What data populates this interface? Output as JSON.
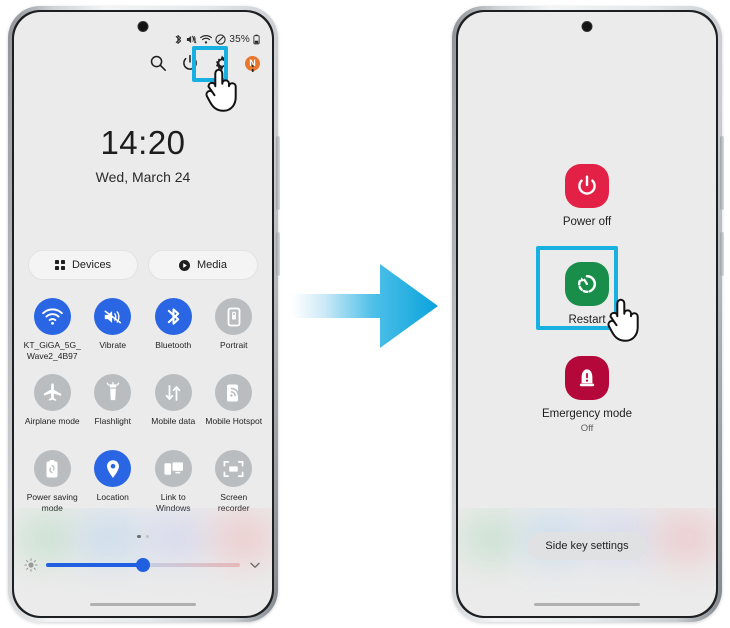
{
  "colors": {
    "highlight": "#18B0E0",
    "arrow": "#1BA8DC",
    "toggle_on": "#2a66e3",
    "toggle_off": "#b9bdc0",
    "power_off_icon": "#e32046",
    "restart_icon": "#188e4a",
    "emergency_icon": "#b4073a",
    "badge": "#e8762c",
    "slider": "#1f5fe0"
  },
  "left_phone": {
    "status_bar": {
      "icons": [
        "bluetooth-icon",
        "mute-icon",
        "wifi-icon",
        "do-not-disturb-icon"
      ],
      "battery_percent": "35%",
      "battery_icon": "battery-icon"
    },
    "quick_panel_actions": {
      "search": "search-icon",
      "power": "power-icon",
      "settings": "gear-icon",
      "badge_letter": "N",
      "more": "more-options-icon"
    },
    "clock": {
      "time": "14:20",
      "date": "Wed, March 24"
    },
    "pills": [
      {
        "label": "Devices",
        "icon": "devices-grid-icon"
      },
      {
        "label": "Media",
        "icon": "media-play-icon"
      }
    ],
    "toggles": [
      {
        "label": "KT_GiGA_5G_Wave2_4B97",
        "icon": "wifi-icon",
        "state": "on"
      },
      {
        "label": "Vibrate",
        "icon": "vibrate-icon",
        "state": "on"
      },
      {
        "label": "Bluetooth",
        "icon": "bluetooth-icon",
        "state": "on"
      },
      {
        "label": "Portrait",
        "icon": "rotation-lock-icon",
        "state": "off"
      },
      {
        "label": "Airplane mode",
        "icon": "airplane-icon",
        "state": "off"
      },
      {
        "label": "Flashlight",
        "icon": "flashlight-icon",
        "state": "off"
      },
      {
        "label": "Mobile data",
        "icon": "mobile-data-icon",
        "state": "off"
      },
      {
        "label": "Mobile Hotspot",
        "icon": "hotspot-icon",
        "state": "off"
      },
      {
        "label": "Power saving mode",
        "icon": "power-saving-icon",
        "state": "off"
      },
      {
        "label": "Location",
        "icon": "location-pin-icon",
        "state": "on"
      },
      {
        "label": "Link to Windows",
        "icon": "link-to-windows-icon",
        "state": "off"
      },
      {
        "label": "Screen recorder",
        "icon": "screen-recorder-icon",
        "state": "off"
      }
    ],
    "brightness": {
      "low_icon": "brightness-low-icon",
      "value_percent": 50,
      "expand_icon": "chevron-down-icon"
    },
    "page_dots": {
      "total": 2,
      "active": 1
    }
  },
  "right_phone": {
    "power_menu": [
      {
        "label": "Power off",
        "sub": "",
        "icon": "power-off-icon"
      },
      {
        "label": "Restart",
        "sub": "",
        "icon": "restart-icon"
      },
      {
        "label": "Emergency mode",
        "sub": "Off",
        "icon": "emergency-mode-icon"
      }
    ],
    "side_key_settings": "Side key settings"
  },
  "annotations": {
    "arrow": "right-arrow",
    "tap_cursor": "tap-hand-cursor",
    "highlight_left": "power-button-highlight",
    "highlight_right": "restart-button-highlight"
  }
}
